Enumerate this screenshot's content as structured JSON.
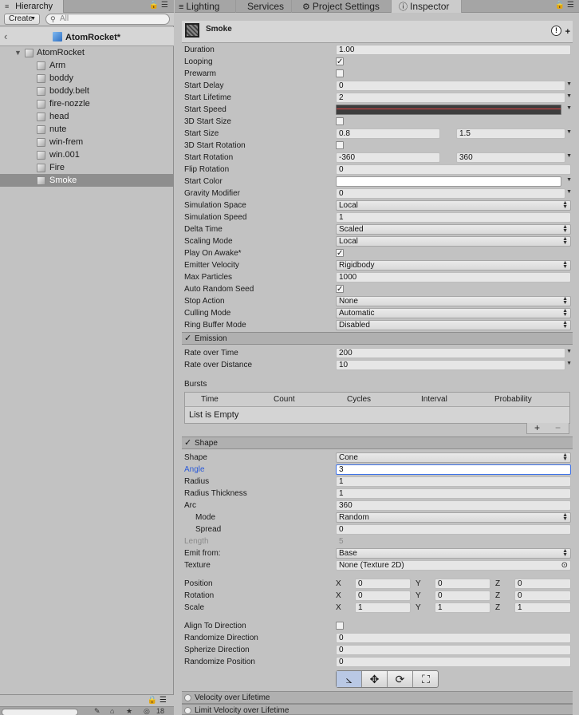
{
  "hierarchy": {
    "tab_label": "Hierarchy",
    "create_label": "Create",
    "search_placeholder": "All",
    "scene_name": "AtomRocket*",
    "root": "AtomRocket",
    "children": [
      "Arm",
      "boddy",
      "boddy.belt",
      "fire-nozzle",
      "head",
      "nute",
      "win-frem",
      "win.001",
      "Fire",
      "Smoke"
    ],
    "selected": "Smoke",
    "footer_count": "18"
  },
  "tabs": [
    {
      "label": "Lighting",
      "icon": "lighting-icon",
      "glyph": "≡"
    },
    {
      "label": "Services",
      "icon": "",
      "glyph": ""
    },
    {
      "label": "Project Settings",
      "icon": "gear-icon",
      "glyph": "⚙"
    },
    {
      "label": "Inspector",
      "icon": "info-icon",
      "glyph": "ⓘ"
    }
  ],
  "inspector": {
    "object_name": "Smoke",
    "main": {
      "duration": {
        "label": "Duration",
        "value": "1.00"
      },
      "looping": {
        "label": "Looping",
        "checked": true
      },
      "prewarm": {
        "label": "Prewarm",
        "checked": false
      },
      "start_delay": {
        "label": "Start Delay",
        "value": "0"
      },
      "start_lifetime": {
        "label": "Start Lifetime",
        "value": "2"
      },
      "start_speed": {
        "label": "Start Speed"
      },
      "start_size_3d": {
        "label": "3D Start Size",
        "checked": false
      },
      "start_size": {
        "label": "Start Size",
        "min": "0.8",
        "max": "1.5"
      },
      "start_rotation_3d": {
        "label": "3D Start Rotation",
        "checked": false
      },
      "start_rotation": {
        "label": "Start Rotation",
        "min": "-360",
        "max": "360"
      },
      "flip_rotation": {
        "label": "Flip Rotation",
        "value": "0"
      },
      "start_color": {
        "label": "Start Color",
        "color": "#ffffff"
      },
      "gravity_modifier": {
        "label": "Gravity Modifier",
        "value": "0"
      },
      "simulation_space": {
        "label": "Simulation Space",
        "value": "Local"
      },
      "simulation_speed": {
        "label": "Simulation Speed",
        "value": "1"
      },
      "delta_time": {
        "label": "Delta Time",
        "value": "Scaled"
      },
      "scaling_mode": {
        "label": "Scaling Mode",
        "value": "Local"
      },
      "play_on_awake": {
        "label": "Play On Awake*",
        "checked": true
      },
      "emitter_velocity": {
        "label": "Emitter Velocity",
        "value": "Rigidbody"
      },
      "max_particles": {
        "label": "Max Particles",
        "value": "1000"
      },
      "auto_random_seed": {
        "label": "Auto Random Seed",
        "checked": true
      },
      "stop_action": {
        "label": "Stop Action",
        "value": "None"
      },
      "culling_mode": {
        "label": "Culling Mode",
        "value": "Automatic"
      },
      "ring_buffer_mode": {
        "label": "Ring Buffer Mode",
        "value": "Disabled"
      }
    },
    "emission": {
      "title": "Emission",
      "rate_over_time": {
        "label": "Rate over Time",
        "value": "200"
      },
      "rate_over_distance": {
        "label": "Rate over Distance",
        "value": "10"
      },
      "bursts_label": "Bursts",
      "bursts_columns": [
        "Time",
        "Count",
        "Cycles",
        "Interval",
        "Probability"
      ],
      "bursts_empty": "List is Empty"
    },
    "shape": {
      "title": "Shape",
      "shape": {
        "label": "Shape",
        "value": "Cone"
      },
      "angle": {
        "label": "Angle",
        "value": "3"
      },
      "radius": {
        "label": "Radius",
        "value": "1"
      },
      "radius_thickness": {
        "label": "Radius Thickness",
        "value": "1"
      },
      "arc": {
        "label": "Arc",
        "value": "360"
      },
      "mode": {
        "label": "Mode",
        "value": "Random"
      },
      "spread": {
        "label": "Spread",
        "value": "0"
      },
      "length": {
        "label": "Length",
        "value": "5"
      },
      "emit_from": {
        "label": "Emit from:",
        "value": "Base"
      },
      "texture": {
        "label": "Texture",
        "value": "None (Texture 2D)"
      },
      "position": {
        "label": "Position",
        "x": "0",
        "y": "0",
        "z": "0"
      },
      "rotation": {
        "label": "Rotation",
        "x": "0",
        "y": "0",
        "z": "0"
      },
      "scale": {
        "label": "Scale",
        "x": "1",
        "y": "1",
        "z": "1"
      },
      "align_to_direction": {
        "label": "Align To Direction",
        "checked": false
      },
      "randomize_direction": {
        "label": "Randomize Direction",
        "value": "0"
      },
      "spherize_direction": {
        "label": "Spherize Direction",
        "value": "0"
      },
      "randomize_position": {
        "label": "Randomize Position",
        "value": "0"
      },
      "axis_labels": {
        "x": "X",
        "y": "Y",
        "z": "Z"
      }
    },
    "modules_collapsed": [
      "Velocity over Lifetime",
      "Limit Velocity over Lifetime"
    ]
  },
  "colors": {
    "panel_bg": "#c2c2c2",
    "selection": "#8e8e8e",
    "focus": "#3f73e8",
    "speed_curve": "#e04545"
  },
  "glyphs": {
    "check": "✓",
    "popup_caret": "▲▼",
    "down_caret": "▼",
    "fold_open": "▼",
    "back": "‹",
    "help": "!",
    "plus": "+",
    "minus": "−",
    "lock": "🔒",
    "menu": "☰",
    "object_picker": "⊙",
    "search": "⚲"
  }
}
